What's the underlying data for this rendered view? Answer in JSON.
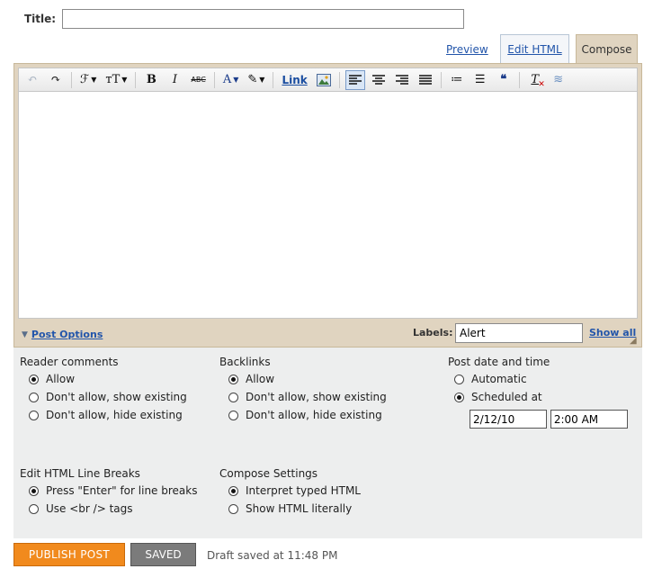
{
  "title_field": {
    "label": "Title:",
    "value": ""
  },
  "mode_tabs": {
    "preview": "Preview",
    "edit_html": "Edit HTML",
    "compose": "Compose"
  },
  "toolbar": {
    "undo_icon": "↶",
    "redo_icon": "↷",
    "font_icon": "ℱ",
    "font_size_icon": "тT",
    "bold": "B",
    "italic": "I",
    "strike": "ABC",
    "text_color": "A",
    "highlight_icon": "✎",
    "link": "Link",
    "numbered_list": "≔",
    "bullet_list": "☰",
    "blockquote": "❝",
    "remove_format": "T",
    "spellcheck": "≋"
  },
  "post_options": {
    "toggle_label": "Post Options",
    "labels_label": "Labels:",
    "labels_value": "Alert",
    "show_all": "Show all"
  },
  "reader_comments": {
    "title": "Reader comments",
    "options": [
      "Allow",
      "Don't allow, show existing",
      "Don't allow, hide existing"
    ],
    "selected": 0
  },
  "backlinks": {
    "title": "Backlinks",
    "options": [
      "Allow",
      "Don't allow, show existing",
      "Don't allow, hide existing"
    ],
    "selected": 0
  },
  "post_date": {
    "title": "Post date and time",
    "options": [
      "Automatic",
      "Scheduled at"
    ],
    "selected": 1,
    "date": "2/12/10",
    "time": "2:00 AM"
  },
  "line_breaks": {
    "title": "Edit HTML Line Breaks",
    "options": [
      "Press \"Enter\" for line breaks",
      "Use <br /> tags"
    ],
    "selected": 0
  },
  "compose_settings": {
    "title": "Compose Settings",
    "options": [
      "Interpret typed HTML",
      "Show HTML literally"
    ],
    "selected": 0
  },
  "actions": {
    "publish": "PUBLISH POST",
    "saved": "SAVED",
    "status": "Draft saved at 11:48 PM"
  },
  "colors": {
    "publish_orange": "#f18a1d",
    "saved_gray": "#7b7b7b",
    "frame_tan": "#e0d4c0",
    "link_blue": "#2255aa"
  }
}
